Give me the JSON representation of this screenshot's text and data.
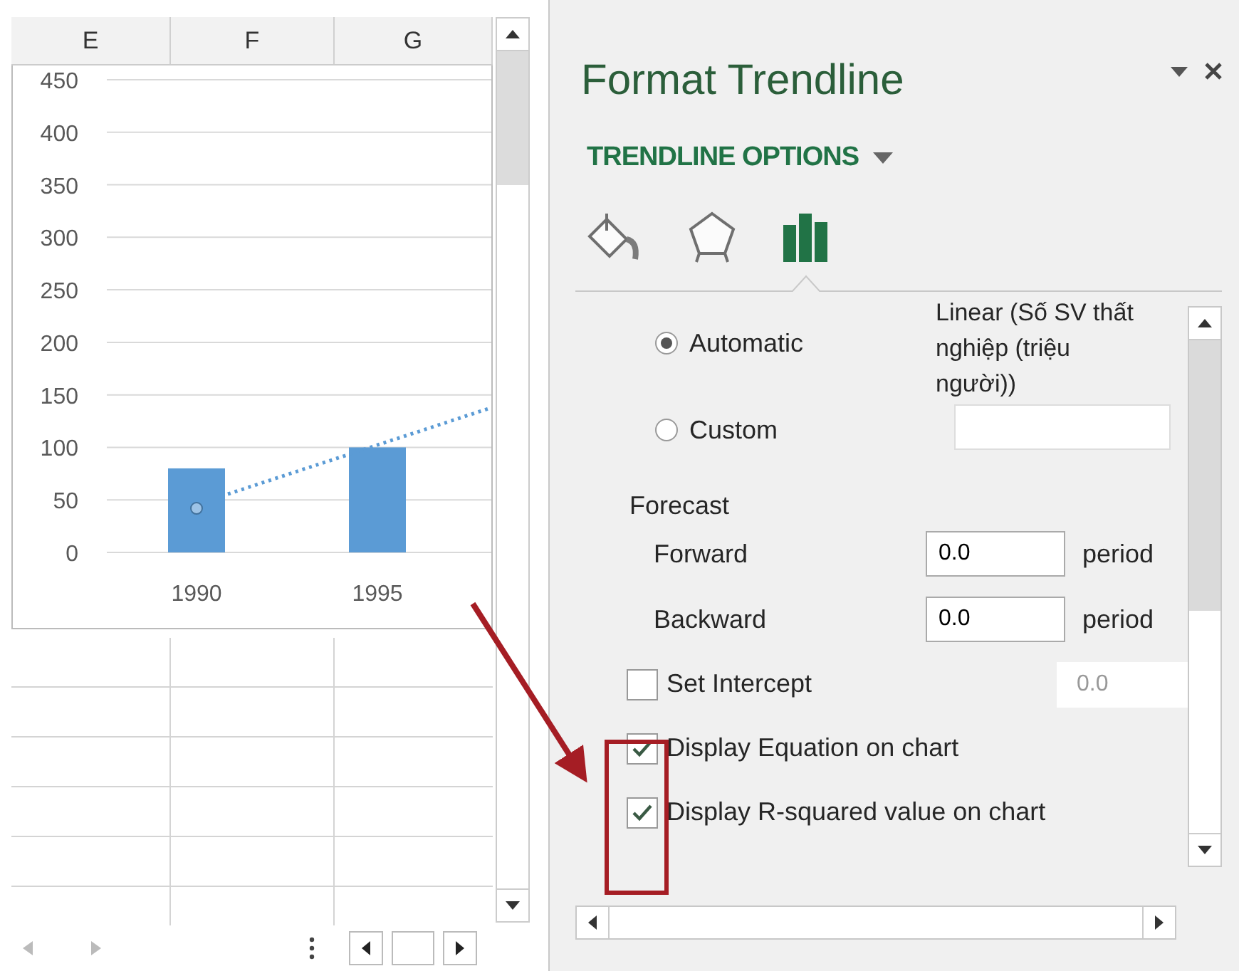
{
  "sheet": {
    "columns": [
      "E",
      "F",
      "G"
    ],
    "chart": {
      "chart_data": {
        "type": "bar",
        "categories": [
          "1990",
          "1995"
        ],
        "values": [
          80,
          100
        ],
        "ylim": [
          0,
          450
        ],
        "yticks": [
          0,
          50,
          100,
          150,
          200,
          250,
          300,
          350,
          400,
          450
        ],
        "grid": true
      }
    }
  },
  "panel": {
    "title": "Format Trendline",
    "section": "TRENDLINE OPTIONS",
    "tabs": [
      {
        "kind": "fill",
        "selected": false
      },
      {
        "kind": "effects",
        "selected": false
      },
      {
        "kind": "options",
        "selected": true
      }
    ],
    "name_options": [
      {
        "label": "Automatic",
        "selected": true
      },
      {
        "label": "Custom",
        "selected": false
      }
    ],
    "trendline_name": "Linear (Số SV thất nghiệp (triệu người))",
    "forecast": {
      "label": "Forecast",
      "rows": [
        {
          "label": "Forward",
          "value": "0.0",
          "unit": "period"
        },
        {
          "label": "Backward",
          "value": "0.0",
          "unit": "period"
        }
      ]
    },
    "checkboxes": [
      {
        "label": "Set Intercept",
        "checked": false,
        "field": {
          "value": "0.0",
          "disabled": true
        }
      },
      {
        "label": "Display Equation on chart",
        "checked": true
      },
      {
        "label": "Display R-squared value on chart",
        "checked": true
      }
    ]
  }
}
